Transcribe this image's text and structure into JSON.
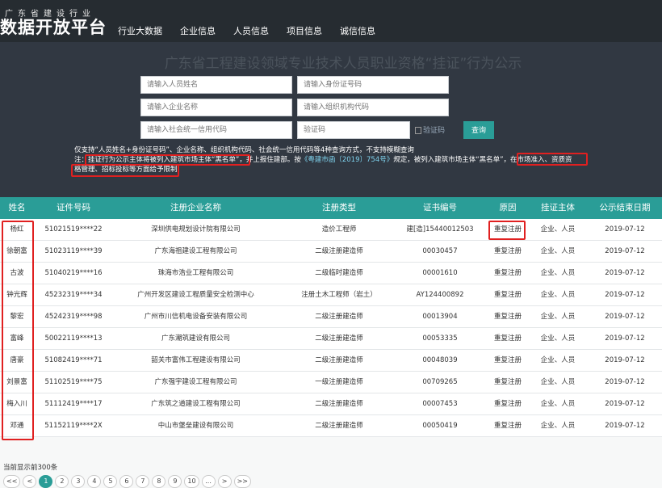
{
  "header": {
    "logo_small": "广东省建设行业",
    "logo_big": "数据开放平台",
    "nav": [
      "行业大数据",
      "企业信息",
      "人员信息",
      "项目信息",
      "诚信信息"
    ]
  },
  "hero": {
    "title": "广东省工程建设领域专业技术人员职业资格“挂证”行为公示"
  },
  "search": {
    "name_placeholder": "请输入人员姓名",
    "id_placeholder": "请输入身份证号码",
    "company_placeholder": "请输入企业名称",
    "org_code_placeholder": "请输入组织机构代码",
    "credit_code_placeholder": "请输入社会统一信用代码",
    "captcha_placeholder": "验证码",
    "captcha_image_alt": "验证码",
    "query_label": "查询"
  },
  "notes": {
    "line1": "仅支持“人员姓名+身份证号码”、企业名称、组织机构代码、社会统一信用代码等4种查询方式，不支持模糊查询",
    "line2_prefix": "注：",
    "line2_highlight1": "挂证行为公示主体将被列入建筑市场主体“黑名单”",
    "line2_mid1": "，并上报住建部。按",
    "line2_link": "《粤建市函〔2019〕754号》",
    "line2_mid2": "规定，被列入建筑市场主体“黑名单”",
    "line2_highlight2": "，在市场准入、资质资",
    "line3_highlight": "格管理、招标投标等方面给予限制"
  },
  "table": {
    "columns": [
      "姓名",
      "证件号码",
      "注册企业名称",
      "注册类型",
      "证书编号",
      "原因",
      "挂证主体",
      "公示结束日期"
    ],
    "rows": [
      [
        "杨红",
        "51021519****22",
        "深圳供电规划设计院有限公司",
        "造价工程师",
        "建[造]15440012503",
        "重复注册",
        "企业、人员",
        "2019-07-12"
      ],
      [
        "徐朝富",
        "51023119****39",
        "广东海祖建设工程有限公司",
        "二级注册建造师",
        "00030457",
        "重复注册",
        "企业、人员",
        "2019-07-12"
      ],
      [
        "古波",
        "51040219****16",
        "珠海市浩业工程有限公司",
        "二级临时建造师",
        "00001610",
        "重复注册",
        "企业、人员",
        "2019-07-12"
      ],
      [
        "钟光辉",
        "45232319****34",
        "广州开发区建设工程质量安全检测中心",
        "注册土木工程师（岩土）",
        "AY124400892",
        "重复注册",
        "企业、人员",
        "2019-07-12"
      ],
      [
        "黎宏",
        "45242319****98",
        "广州市川信机电设备安装有限公司",
        "二级注册建造师",
        "00013904",
        "重复注册",
        "企业、人员",
        "2019-07-12"
      ],
      [
        "富峰",
        "50022119****13",
        "广东潮筑建设有限公司",
        "二级注册建造师",
        "00053335",
        "重复注册",
        "企业、人员",
        "2019-07-12"
      ],
      [
        "唐豪",
        "51082419****71",
        "韶关市富伟工程建设有限公司",
        "二级注册建造师",
        "00048039",
        "重复注册",
        "企业、人员",
        "2019-07-12"
      ],
      [
        "刘景富",
        "51102519****75",
        "广东强宇建设工程有限公司",
        "一级注册建造师",
        "00709265",
        "重复注册",
        "企业、人员",
        "2019-07-12"
      ],
      [
        "梅入川",
        "51112419****17",
        "广东筑之道建设工程有限公司",
        "二级注册建造师",
        "00007453",
        "重复注册",
        "企业、人员",
        "2019-07-12"
      ],
      [
        "邓通",
        "51152119****2X",
        "中山市堡垒建设有限公司",
        "二级注册建造师",
        "00050419",
        "重复注册",
        "企业、人员",
        "2019-07-12"
      ]
    ]
  },
  "footer": {
    "count_text": "当前显示前300条",
    "pages": [
      "<<",
      "<",
      "1",
      "2",
      "3",
      "4",
      "5",
      "6",
      "7",
      "8",
      "9",
      "10",
      "...",
      ">",
      ">>"
    ]
  },
  "colors": {
    "topbar": "#262c31",
    "hero": "#313842",
    "accent": "#2a9d97",
    "highlight_box": "#e02020"
  }
}
